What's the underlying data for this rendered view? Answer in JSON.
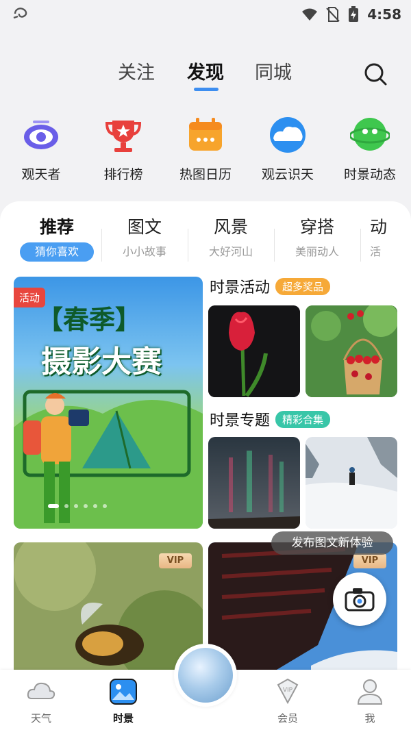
{
  "status_bar": {
    "time": "4:58"
  },
  "top_tabs": [
    {
      "label": "关注"
    },
    {
      "label": "发现",
      "active": true
    },
    {
      "label": "同城"
    }
  ],
  "quick_items": [
    {
      "label": "观天者",
      "icon": "eye-icon"
    },
    {
      "label": "排行榜",
      "icon": "trophy-icon"
    },
    {
      "label": "热图日历",
      "icon": "calendar-icon"
    },
    {
      "label": "观云识天",
      "icon": "cloud-icon"
    },
    {
      "label": "时景动态",
      "icon": "chat-bubble-icon"
    }
  ],
  "categories": [
    {
      "title": "推荐",
      "subtitle": "猜你喜欢",
      "active": true
    },
    {
      "title": "图文",
      "subtitle": "小小故事"
    },
    {
      "title": "风景",
      "subtitle": "大好河山"
    },
    {
      "title": "穿搭",
      "subtitle": "美丽动人"
    },
    {
      "title": "动",
      "subtitle": "活"
    }
  ],
  "banner": {
    "badge": "活动",
    "title_line1": "【春季】",
    "title_line2": "摄影大赛"
  },
  "activity_section": {
    "title": "时景活动",
    "tag": "超多奖品"
  },
  "topic_section": {
    "title": "时景专题",
    "tag": "精彩合集"
  },
  "vip_label": "VIP",
  "publish_tip": "发布图文新体验",
  "bottom_nav": [
    {
      "label": "天气",
      "icon": "weather-cloud-icon"
    },
    {
      "label": "时景",
      "icon": "photo-icon",
      "active": true
    },
    {
      "label": "会员",
      "icon": "vip-diamond-icon"
    },
    {
      "label": "我",
      "icon": "user-icon"
    }
  ],
  "colors": {
    "accent": "#3d8ef0",
    "activity_tag": "#f6a938",
    "topic_tag": "#38c6a8",
    "activity_badge": "#e8463e"
  }
}
